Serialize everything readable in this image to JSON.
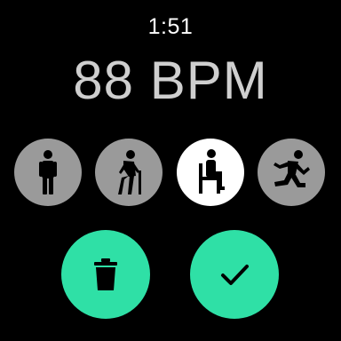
{
  "status": {
    "time": "1:51"
  },
  "heart_rate": {
    "display": "88 BPM"
  },
  "activities": [
    {
      "icon": "standing-person-icon",
      "selected": false
    },
    {
      "icon": "walking-elderly-person-icon",
      "selected": false
    },
    {
      "icon": "seated-person-icon",
      "selected": true
    },
    {
      "icon": "running-person-icon",
      "selected": false
    }
  ],
  "actions": {
    "delete_icon": "trash-icon",
    "confirm_icon": "checkmark-icon"
  },
  "colors": {
    "background": "#000000",
    "accent": "#2fe0a6",
    "unselected": "#9a9a9a",
    "selected": "#ffffff",
    "bpm_text": "#cfcfcf"
  }
}
